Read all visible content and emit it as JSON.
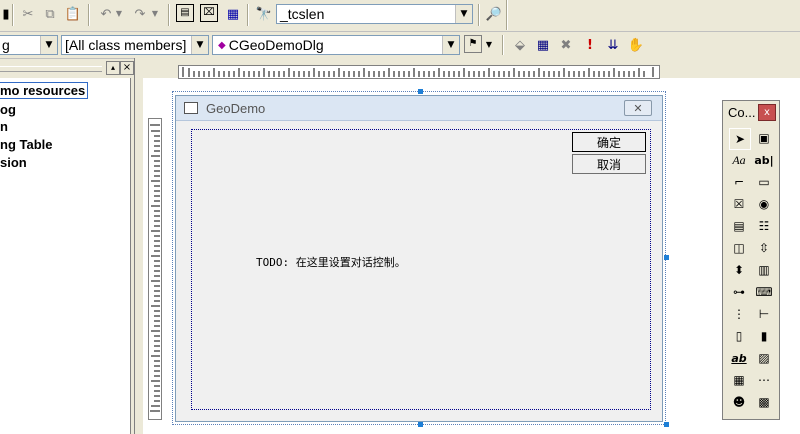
{
  "toolbar1": {
    "find_combo_value": "_tcslen"
  },
  "toolbar2": {
    "class_combo_left_value": "g",
    "members_combo_value": "[All class members]",
    "function_combo_value": "CGeoDemoDlg"
  },
  "resource_tree": {
    "items": [
      "mo resources",
      "og",
      "n",
      "ng Table",
      "sion"
    ]
  },
  "dialog": {
    "title": "GeoDemo",
    "ok_label": "确定",
    "cancel_label": "取消",
    "todo_text": "TODO: 在这里设置对话控制。"
  },
  "controls_toolbox": {
    "title": "Co...",
    "close_label": "x"
  },
  "colors": {
    "accent": "#316ac5",
    "handle": "#1e7fd6"
  }
}
